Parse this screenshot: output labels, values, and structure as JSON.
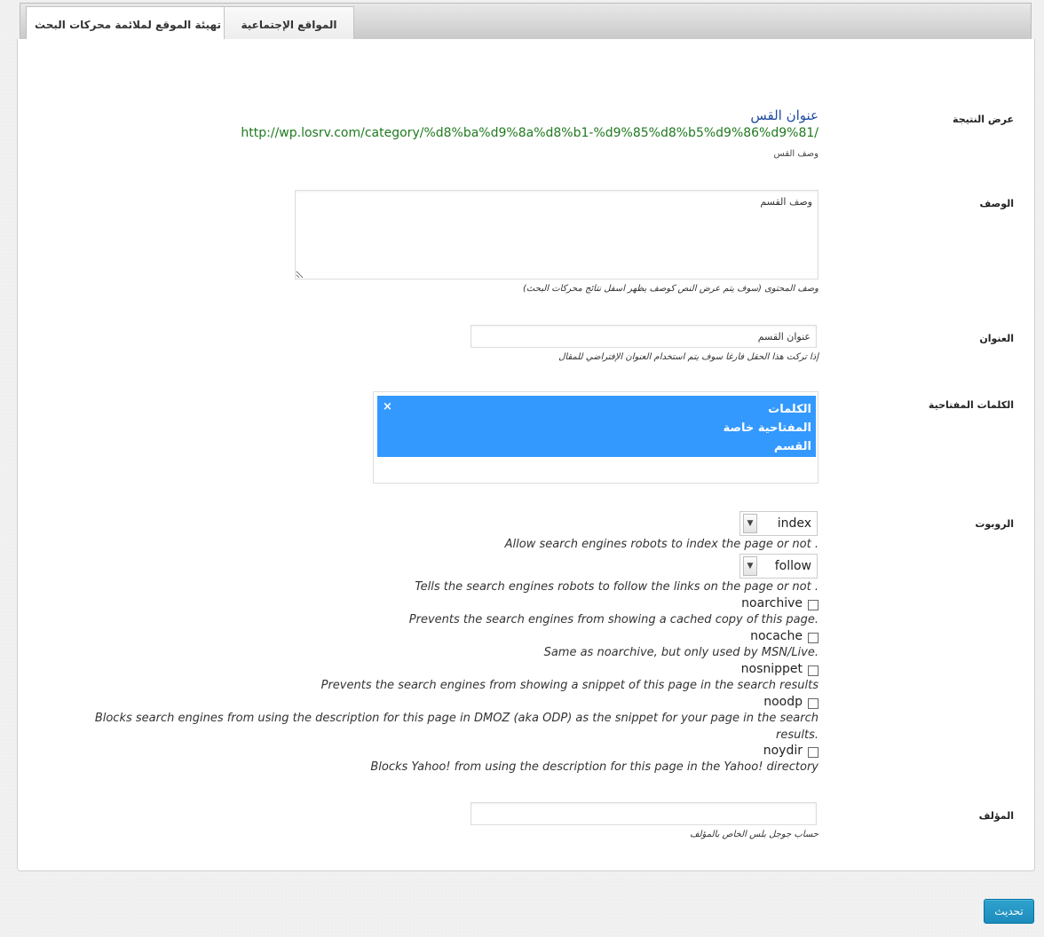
{
  "tabs": {
    "seo": "تهيئة الموقع لملائمة محركات البحث",
    "social": "المواقع الإجتماعية"
  },
  "snippet": {
    "label": "عرض النتيجة",
    "title": "عنوان القس",
    "url": "http://wp.losrv.com/category/%d8%ba%d9%8a%d8%b1-%d9%85%d8%b5%d9%86%d9%81/",
    "description": "وصف القس"
  },
  "description": {
    "label": "الوصف",
    "value": "وصف القسم",
    "help": "وصف المحتوى (سوف يتم عرض النص كوصف يظهر اسفل نتائج محركات البحث)"
  },
  "title": {
    "label": "العنوان",
    "value": "عنوان القسم",
    "help": "إذا تركت هذا الحقل فارغا سوف يتم استخدام العنوان الإفتراضي للمقال"
  },
  "keywords": {
    "label": "الكلمات المفتاحية",
    "tag_line1": "الكلمات",
    "tag_line2": "المفتاحية خاصة",
    "tag_line3": "القسم",
    "close_glyph": "×"
  },
  "robots": {
    "label": "الروبوت",
    "index_value": "index",
    "index_help": "Allow search engines robots to index the page or not .",
    "follow_value": "follow",
    "follow_help": "Tells the search engines robots to follow the links on the page or not .",
    "options": [
      {
        "label": "noarchive",
        "help": "Prevents the search engines from showing a cached copy of this page.",
        "checked": false
      },
      {
        "label": "nocache",
        "help": "Same as noarchive, but only used by MSN/Live.",
        "checked": false
      },
      {
        "label": "nosnippet",
        "help": "Prevents the search engines from showing a snippet of this page in the search results",
        "checked": false
      },
      {
        "label": "noodp",
        "help_line1": "Blocks search engines from using the description for this page in DMOZ (aka ODP) as the snippet for your page in the search",
        "help_line2": "results.",
        "checked": false
      },
      {
        "label": "noydir",
        "help": "Blocks Yahoo! from using the description for this page in the Yahoo! directory",
        "checked": false
      }
    ]
  },
  "author": {
    "label": "المؤلف",
    "value": "",
    "help": "حساب جوجل بلس الخاص بالمؤلف"
  },
  "update_button": "تحديث"
}
